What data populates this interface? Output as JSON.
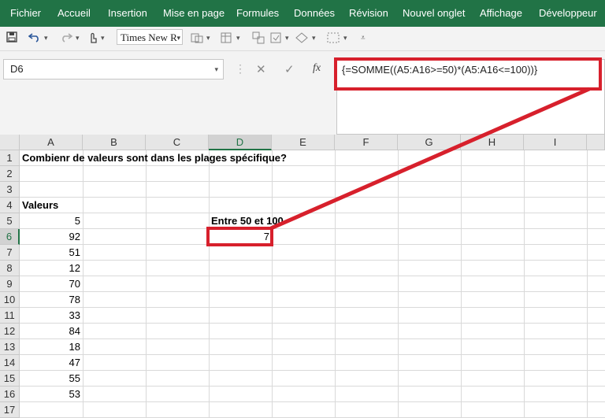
{
  "ribbon": {
    "tabs": [
      "Fichier",
      "Accueil",
      "Insertion",
      "Mise en page",
      "Formules",
      "Données",
      "Révision",
      "Nouvel onglet",
      "Affichage",
      "Développeur"
    ]
  },
  "toolbar": {
    "font_name": "Times New R"
  },
  "formula_bar": {
    "name_box": "D6",
    "cancel_symbol": "✕",
    "enter_symbol": "✓",
    "fx_label": "fx",
    "formula": "{=SOMME((A5:A16>=50)*(A5:A16<=100))}"
  },
  "sheet": {
    "columns": [
      "A",
      "B",
      "C",
      "D",
      "E",
      "F",
      "G",
      "H",
      "I"
    ],
    "selected_column": "D",
    "rows": [
      "1",
      "2",
      "3",
      "4",
      "5",
      "6",
      "7",
      "8",
      "9",
      "10",
      "11",
      "12",
      "13",
      "14",
      "15",
      "16",
      "17"
    ],
    "selected_row": "6",
    "cells": {
      "A1": "Combienr de valeurs sont dans les plages spécifique?",
      "A4": "Valeurs",
      "D5": "Entre 50 et 100",
      "D6": "7"
    },
    "values_column": [
      "5",
      "92",
      "51",
      "12",
      "70",
      "78",
      "33",
      "84",
      "18",
      "47",
      "55",
      "53"
    ]
  },
  "colors": {
    "ribbon": "#217346",
    "highlight": "#d7202c"
  }
}
